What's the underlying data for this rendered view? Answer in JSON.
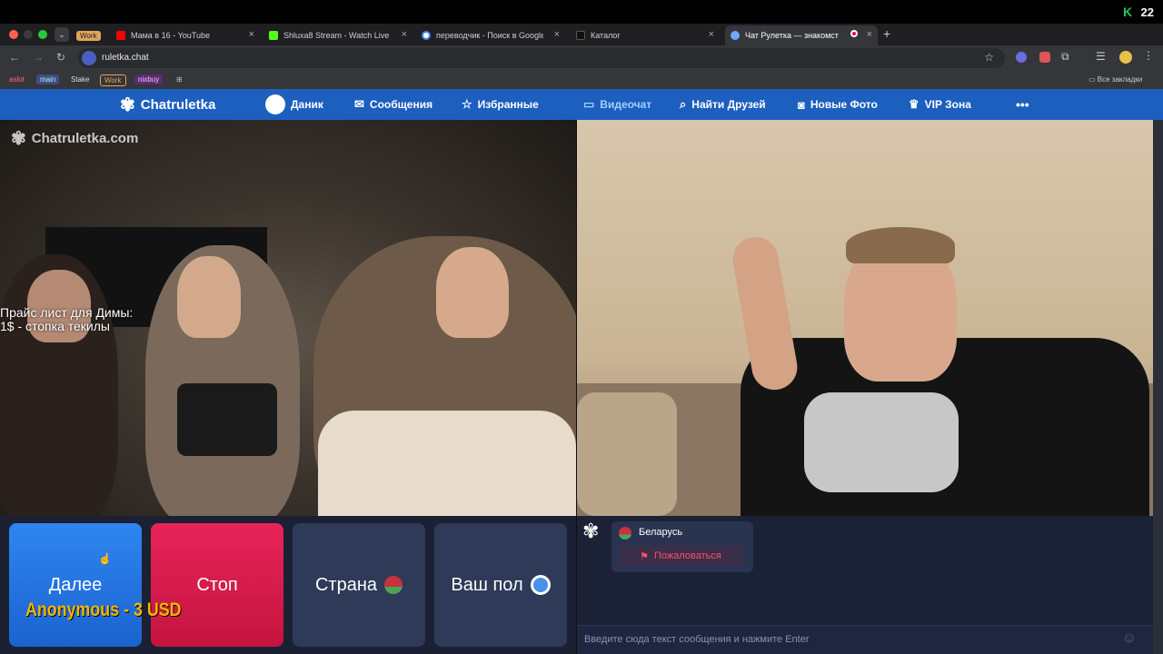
{
  "os": {
    "right_number": "22"
  },
  "tabs": [
    {
      "label": "Work",
      "kind": "badge"
    },
    {
      "label": "Мама в 16 - YouTube"
    },
    {
      "label": "Shluxa8 Stream - Watch Live"
    },
    {
      "label": "переводчик - Поиск в Google"
    },
    {
      "label": "Каталог"
    },
    {
      "label": "Чат Рулетка — знакомст",
      "active": true
    }
  ],
  "address": {
    "url": "ruletka.chat"
  },
  "bookmarks": [
    "aslot",
    "main",
    "Stake",
    "Work",
    "nixbuy"
  ],
  "all_bookmarks": "Все закладки",
  "site": {
    "logo": "Chatruletka",
    "nav": [
      {
        "label": "Даник",
        "icon": "avatar-icon"
      },
      {
        "label": "Сообщения",
        "icon": "mail-icon"
      },
      {
        "label": "Избранные",
        "icon": "star-icon"
      },
      {
        "label": "Видеочат",
        "icon": "video-icon",
        "active": true
      },
      {
        "label": "Найти Друзей",
        "icon": "search-icon"
      },
      {
        "label": "Новые Фото",
        "icon": "camera-icon"
      },
      {
        "label": "VIP Зона",
        "icon": "crown-icon"
      }
    ],
    "more": "•••"
  },
  "video": {
    "watermark": "Chatruletka.com",
    "overlay_line1": "Прайс лист для Димы:",
    "overlay_line2": "1$ - стопка текилы"
  },
  "controls": {
    "next": "Далее",
    "stop": "Стоп",
    "country": "Страна",
    "gender": "Ваш пол"
  },
  "donation": "Anonymous - 3 USD",
  "chat": {
    "country_name": "Беларусь",
    "report": "Пожаловаться",
    "input_placeholder": "Введите сюда текст сообщения и нажмите Enter"
  },
  "colors": {
    "nav": "#1d5fbf",
    "next": "#1a6fe0",
    "stop": "#d81b4a",
    "neutral": "#2e3a58"
  }
}
